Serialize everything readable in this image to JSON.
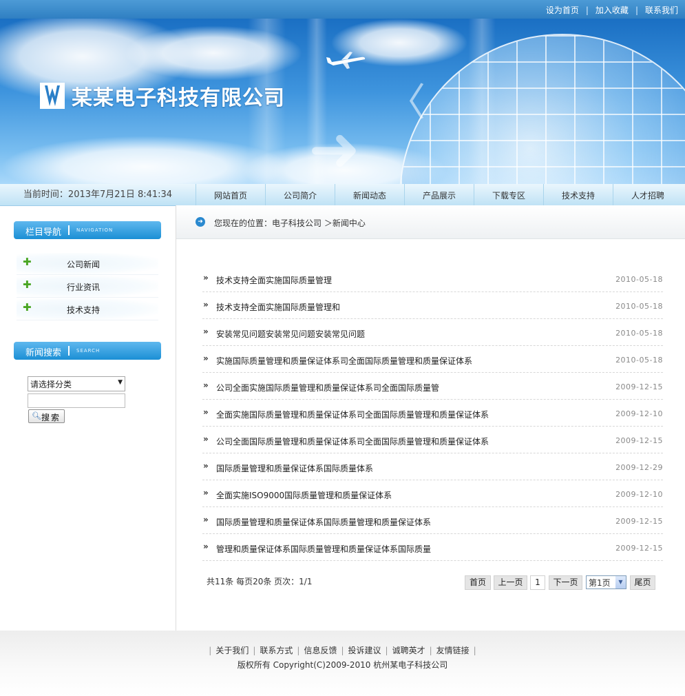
{
  "topbar": {
    "links": [
      "设为首页",
      "加入收藏",
      "联系我们"
    ],
    "separator": "|"
  },
  "banner": {
    "company_name": "某某电子科技有限公司"
  },
  "nav": {
    "time_label": "当前时间：2013年7月21日  8:41:34",
    "items": [
      "网站首页",
      "公司简介",
      "新闻动态",
      "产品展示",
      "下载专区",
      "技术支持",
      "人才招聘"
    ]
  },
  "sidebar": {
    "nav_title": "栏目导航",
    "nav_title_en": "NAVIGATION",
    "items": [
      "公司新闻",
      "行业资讯",
      "技术支持"
    ],
    "search_title": "新闻搜索",
    "search_title_en": "SEARCH",
    "category_select": "请选择分类",
    "keyword_value": "",
    "search_button": "搜索"
  },
  "breadcrumb": {
    "text": "您现在的位置：电子科技公司 ＞新闻中心"
  },
  "news": [
    {
      "title": "技术支持全面实施国际质量管理",
      "date": "2010-05-18"
    },
    {
      "title": "技术支持全面实施国际质量管理和",
      "date": "2010-05-18"
    },
    {
      "title": "安装常见问题安装常见问题安装常见问题",
      "date": "2010-05-18"
    },
    {
      "title": "实施国际质量管理和质量保证体系司全面国际质量管理和质量保证体系",
      "date": "2010-05-18"
    },
    {
      "title": "公司全面实施国际质量管理和质量保证体系司全面国际质量管",
      "date": "2009-12-15"
    },
    {
      "title": "全面实施国际质量管理和质量保证体系司全面国际质量管理和质量保证体系",
      "date": "2009-12-10"
    },
    {
      "title": "公司全面国际质量管理和质量保证体系司全面国际质量管理和质量保证体系",
      "date": "2009-12-15"
    },
    {
      "title": "国际质量管理和质量保证体系国际质量体系",
      "date": "2009-12-29"
    },
    {
      "title": "全面实施ISO9000国际质量管理和质量保证体系",
      "date": "2009-12-10"
    },
    {
      "title": "国际质量管理和质量保证体系国际质量管理和质量保证体系",
      "date": "2009-12-15"
    },
    {
      "title": "管理和质量保证体系国际质量管理和质量保证体系国际质量",
      "date": "2009-12-15"
    }
  ],
  "pagination": {
    "info": "共11条  每页20条  页次：1/1",
    "first": "首页",
    "prev": "上一页",
    "current": "1",
    "next": "下一页",
    "page_select": "第1页",
    "last": "尾页"
  },
  "footer": {
    "links": [
      "关于我们",
      "联系方式",
      "信息反馈",
      "投诉建议",
      "诚聘英才",
      "友情链接"
    ],
    "copyright": "版权所有  Copyright(C)2009-2010 杭州某电子科技公司"
  }
}
